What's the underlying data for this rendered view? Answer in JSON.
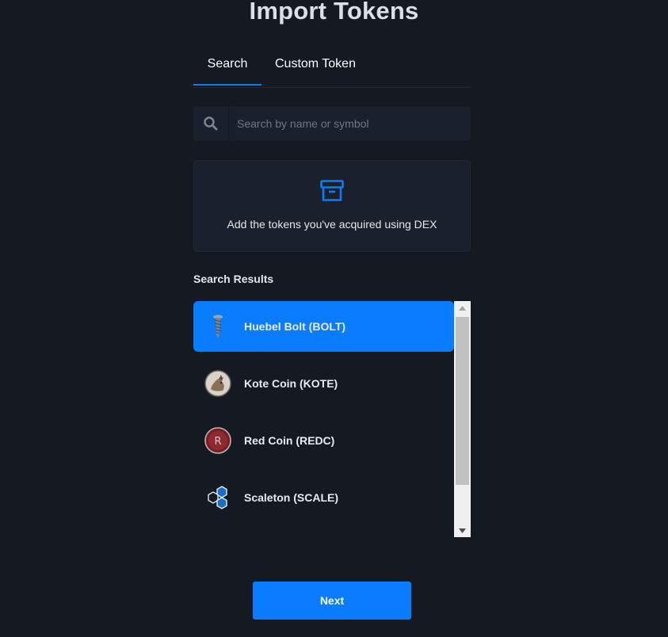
{
  "header": {
    "title": "Import Tokens"
  },
  "tabs": [
    {
      "label": "Search",
      "active": true
    },
    {
      "label": "Custom Token",
      "active": false
    }
  ],
  "search": {
    "placeholder": "Search by name or symbol",
    "value": "",
    "icon": "search-icon"
  },
  "info": {
    "icon": "archive-box-icon",
    "text": "Add the tokens you've acquired using DEX",
    "accent": "#0a7cff"
  },
  "results": {
    "title": "Search Results",
    "items": [
      {
        "label": "Huebel Bolt (BOLT)",
        "icon": "bolt-screw-icon",
        "selected": true
      },
      {
        "label": "Kote Coin (KOTE)",
        "icon": "kote-coin-icon",
        "selected": false
      },
      {
        "label": "Red Coin (REDC)",
        "icon": "red-coin-icon",
        "selected": false
      },
      {
        "label": "Scaleton (SCALE)",
        "icon": "scaleton-hexagon-icon",
        "selected": false
      }
    ]
  },
  "footer": {
    "next_label": "Next"
  },
  "colors": {
    "background": "#151a22",
    "panel": "#1b212c",
    "accent": "#0a7cff"
  }
}
